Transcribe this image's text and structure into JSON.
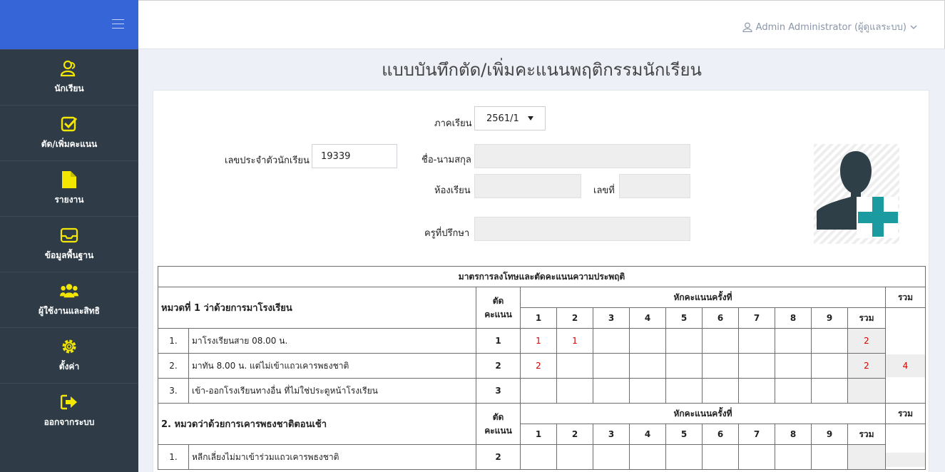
{
  "header": {
    "user_label": "Admin Administrator (ผู้ดูแลระบบ)"
  },
  "sidebar": {
    "items": [
      {
        "label": "นักเรียน",
        "icon": "user-outline-icon"
      },
      {
        "label": "ตัด/เพิ่มคะแนน",
        "icon": "check-square-icon"
      },
      {
        "label": "รายงาน",
        "icon": "file-icon"
      },
      {
        "label": "ข้อมูลพื้นฐาน",
        "icon": "inbox-icon"
      },
      {
        "label": "ผู้ใช้งานและสิทธิ",
        "icon": "users-icon"
      },
      {
        "label": "ตั้งค่า",
        "icon": "gear-icon"
      },
      {
        "label": "ออกจากระบบ",
        "icon": "sign-out-icon"
      }
    ],
    "accent": "#f3e600"
  },
  "page": {
    "title": "แบบบันทึกตัด/เพิ่มคะแนนพฤติกรรมนักเรียน"
  },
  "form": {
    "semester_label": "ภาคเรียน",
    "semester_value": "2561/1",
    "student_id_label": "เลขประจำตัวนักเรียน",
    "student_id_value": "19339",
    "name_label": "ชื่อ-นามสกุล",
    "room_label": "ห้องเรียน",
    "number_label": "เลขที่",
    "advisor_label": "ครูที่ปรึกษา"
  },
  "table": {
    "title": "มาตรการลงโทษและตัดคะแนนความประพฤติ",
    "deduct_label": "ตัด",
    "points_label": "คะแนน",
    "times_label": "หักคะแนนครั้งที่",
    "total_label": "รวม",
    "time_numbers": [
      "1",
      "2",
      "3",
      "4",
      "5",
      "6",
      "7",
      "8",
      "9"
    ],
    "categories": [
      {
        "title": "หมวดที่ 1 ว่าด้วยการมาโรงเรียน",
        "category_total": "4",
        "rows": [
          {
            "no": "1.",
            "desc": "มาโรงเรียนสาย 08.00 น.",
            "points": "1",
            "marks": [
              "1",
              "1",
              "",
              "",
              "",
              "",
              "",
              "",
              ""
            ],
            "total": "2"
          },
          {
            "no": "2.",
            "desc": "มาทัน 8.00 น. แต่ไม่เข้าแถวเคารพธงชาติ",
            "points": "2",
            "marks": [
              "2",
              "",
              "",
              "",
              "",
              "",
              "",
              "",
              ""
            ],
            "total": "2"
          },
          {
            "no": "3.",
            "desc": "เข้า-ออกโรงเรียนทางอื่น ที่ไม่ใช่ประตูหน้าโรงเรียน",
            "points": "3",
            "marks": [
              "",
              "",
              "",
              "",
              "",
              "",
              "",
              "",
              ""
            ],
            "total": ""
          }
        ]
      },
      {
        "title": "2. หมวดว่าด้วยการเคารพธงชาติตอนเช้า",
        "category_total": "",
        "rows": [
          {
            "no": "1.",
            "desc": "หลีกเลี่ยงไม่มาเข้าร่วมแถวเคารพธงชาติ",
            "points": "2",
            "marks": [
              "",
              "",
              "",
              "",
              "",
              "",
              "",
              "",
              ""
            ],
            "total": ""
          }
        ]
      }
    ]
  }
}
